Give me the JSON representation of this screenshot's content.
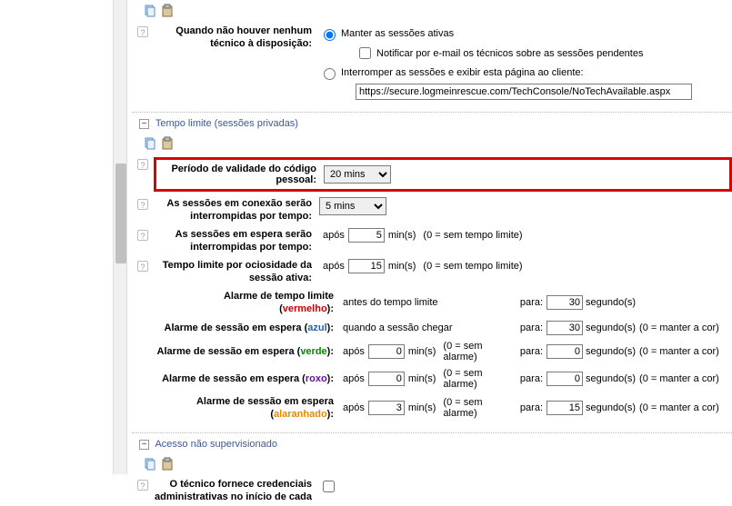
{
  "top": {
    "keep_active": "Manter as sessões ativas",
    "notify_email": "Notificar por e-mail os técnicos sobre as sessões pendentes",
    "interrupt": "Interromper as sessões e exibir esta página ao cliente:",
    "url": "https://secure.logmeinrescue.com/TechConsole/NoTechAvailable.aspx",
    "no_tech_label1": "Quando não houver nenhum",
    "no_tech_label2": "técnico à disposição:"
  },
  "section_timeout_title": "Tempo limite (sessões privadas)",
  "fields": {
    "pin_validity_label1": "Período de validade do código",
    "pin_validity_label2": "pessoal:",
    "pin_validity_value": "20 mins",
    "conn_sessions_label1": "As sessões em conexão serão",
    "conn_sessions_label2": "interrompidas por tempo:",
    "conn_sessions_value": "5 mins",
    "wait_sessions_label1": "As sessões em espera serão",
    "wait_sessions_label2": "interrompidas por tempo:",
    "wait_sessions_value": "5",
    "idle_label1": "Tempo limite por ociosidade da",
    "idle_label2": "sessão ativa:",
    "idle_value": "15",
    "after_prefix": "após",
    "min_suffix": "min(s)",
    "no_limit": "(0 = sem tempo limite)",
    "no_alarm": "(0 = sem alarme)",
    "no_keepcolor": "(0 = manter a cor)",
    "para": "para:",
    "seg_suffix": "segundo(s)"
  },
  "alarms": {
    "red_label_a": "Alarme de tempo limite",
    "red_label_b": "(",
    "red_color": "vermelho",
    "red_label_c": "):",
    "red_before": "antes do tempo limite",
    "red_para_val": "30",
    "blue_label": "Alarme de sessão em espera (",
    "blue_color": "azul",
    "blue_label_c": "):",
    "blue_when": "quando a sessão chegar",
    "blue_para_val": "30",
    "green_label": "Alarme de sessão em espera (",
    "green_color": "verde",
    "green_label_c": "):",
    "green_after_val": "0",
    "green_para_val": "0",
    "purple_label": "Alarme de sessão em espera (",
    "purple_color": "roxo",
    "purple_label_c": "):",
    "purple_after_val": "0",
    "purple_para_val": "0",
    "orange_label_a": "Alarme de sessão em espera",
    "orange_label_b": "(",
    "orange_color": "alaranhado",
    "orange_label_c": "):",
    "orange_after_val": "3",
    "orange_para_val": "15"
  },
  "section_unattended_title": "Acesso não supervisionado",
  "unattended": {
    "cred_label1": "O técnico fornece credenciais",
    "cred_label2": "administrativas no início de cada"
  }
}
